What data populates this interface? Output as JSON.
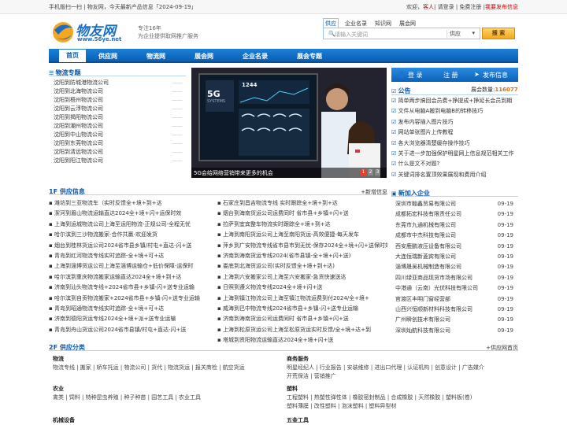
{
  "topbar": {
    "left": "手机版扫一扫 | 物友网，今天最新产品信息「2024-09-19」",
    "welcome": "欢迎，",
    "guest": "客人",
    "login_reg": "| 请登录 | 免费注册 |",
    "publish": "我要发布信息"
  },
  "logo": {
    "cn": "物友网",
    "url": "www.56ye.net"
  },
  "slogan": {
    "line1": "专注16年",
    "line2": "为企业提供取网推广服务"
  },
  "search": {
    "tabs": [
      "供应",
      "企业名录",
      "知识网",
      "展会网"
    ],
    "placeholder": "请输入关键词",
    "select": "供应",
    "button": "搜 索"
  },
  "nav": {
    "items": [
      "首页",
      "供应网",
      "物流网",
      "展会网",
      "企业名录",
      "展会专题"
    ]
  },
  "logistics": {
    "title": "物流专题",
    "items": [
      "沈阳到防城港物流公司",
      "沈阳到北海物流公司",
      "沈阳到梧州物流公司",
      "沈阳到云浮物流公司",
      "沈阳到揭阳物流公司",
      "沈阳到潮州物流公司",
      "沈阳到中山物流公司",
      "沈阳到东莞物流公司",
      "沈阳到清远物流公司",
      "沈阳到阳江物流公司"
    ]
  },
  "banner": {
    "caption": "5G会给网络营销带来更多的机会",
    "pages": [
      "1",
      "2",
      "3"
    ],
    "screen_label": "5G",
    "screen_sub": "SYSTEMS",
    "screen_num": "1244"
  },
  "account": {
    "login": "登 录",
    "register": "注 册",
    "publish": "发布信息",
    "count_label": "展会数量:",
    "count": "116077"
  },
  "notice": {
    "title": "公告",
    "items": [
      "简单两步搞回会员费+挣提成+挣延长会员到期",
      "文件从电脑A搬到电脑B的转移技巧",
      "发布内容插入图片技巧",
      "网站单张图片上传教程",
      "各大浏览器清楚缓存操作技巧",
      "关于进一步加强保护明星网上信息规范相关工作",
      "什么是文不对题?",
      "关键词排名置顶效果展现和费用介绍"
    ]
  },
  "supply": {
    "title": "1F 供应信息",
    "more": "+新增信息",
    "col1": [
      "潍坊到三亚物流车（实时反馈全+境+到+达",
      "潔河到眉山物流运输直达2024全+境+闪+运保时效",
      "上海到运城物流公司上海至运阳物流-正规公司-全程无忧",
      "哈尔滨到三沙物流搬家-合作共赢-欢迎发货",
      "烟台到桂林货运公司2024省市县乡镇/村屯+直达-闪+送",
      "青岛到红河物流专线实时追踪-全+境+可+达",
      "上海到淄博货运公司上海至淄博运输仓+低价保障-运保时",
      "哈尔滨到重庆物流搬家运输直达2024全+境+到+达",
      "济南到汕头物流专线+2024省市县+乡镇-闪+送专业运输",
      "哈尔滨到自贡物流搬家+2024省市县+乡镇-闪+送专业运输",
      "青岛到昭通物流专线实时追踪-全+境+可+达",
      "济南到德阳货运专线2024全+境+派+送专业运输",
      "青岛到舟山货运公司2024省市县镇/村屯+直达-闪+送"
    ],
    "col2": [
      "石家庄到昌吉物流专线 实时跟踪全+境+到+达",
      "烟台到海南货运公司运费同时 省市县+乡镇+闪+送",
      "拉萨到宜宾整车物流实时跟踪全+境+到+达",
      "上海到南阳货运公司上海至南阳货运-高效便捷-每天发车",
      "萍乡到广安物流专线省市县市到无忧-保存2024全+境+闪+送保时效",
      "济南到海南货运专线2024(省市县镇-全+境+闪+送)",
      "娄底到北海货运公司(实时反馈全+境+到+达)",
      "上海到六安搬家公司上海至六安搬家-急货快速送达",
      "日照到遵义物流专线2024全+境+闪+送",
      "上海到镇江物流公司上海至镇江物流运费到付2024/全+境+",
      "威海到巴中物流专线2024省市县+乡镇-闪+送专业运输",
      "济南到海南货运公司运费同时 省市县+乡镇+闪+送",
      "上海到松原货运公司上海至松原货运实时反馈/全+境+达+到",
      "塔城到资阳物流运输直达2024全+境+闪+送"
    ]
  },
  "newcorp": {
    "title": "新加入企业",
    "items": [
      "深圳市翰鑫贸易有限公司",
      "成都拓宏科技有限责任公司",
      "东莞市九通机械有限公司",
      "成都市中杰科技有限公司",
      "西安鹿鹏液压设备有限公司",
      "大连恒瑞新菱宾有限公司",
      "淄博晟吴机械制造有限公司",
      "四川绿亚商品现货市场有限公司",
      "中港通（云南）光伏科技有限公司",
      "官渡区丰明门窗经营部",
      "山西兴恒顺新材料科技有限公司",
      "广州瞬创技术有限公司",
      "深圳灿航科技有限公司"
    ],
    "date": "09-19"
  },
  "gcat": {
    "title": "2F 供应分类",
    "more": "+供应网首页",
    "wuliu": {
      "t": "物流",
      "i": "物流专线 | 搬家 | 轿车托运 | 物流公司 | 货代 | 物流货运 | 报关商检 | 航空货运"
    },
    "shangwu": {
      "t": "商务服务",
      "i1": "明星经纪人 | 行业报告 | 安装维修 | 进出口代理 | 认证机构 | 创意设计 | 广告媒介",
      "i2": "开荒保洁 | 营销推广"
    },
    "nongye": {
      "t": "农业",
      "i": "禽类 | 饲料 | 特种昆虫养殖 | 种子种苗 | 园艺工具 | 农业工具"
    },
    "suliao": {
      "t": "塑料",
      "i1": "工程塑料 | 热塑性弹性体 | 橡胶密封制品 | 合成橡胶 | 天然橡胶 | 塑料板(卷)",
      "i2": "塑料薄膜 | 改性塑料 | 泡沫塑料 | 塑料异型材"
    },
    "jixie": {
      "t": "机械设备"
    },
    "wujin": {
      "t": "五金工具"
    }
  }
}
